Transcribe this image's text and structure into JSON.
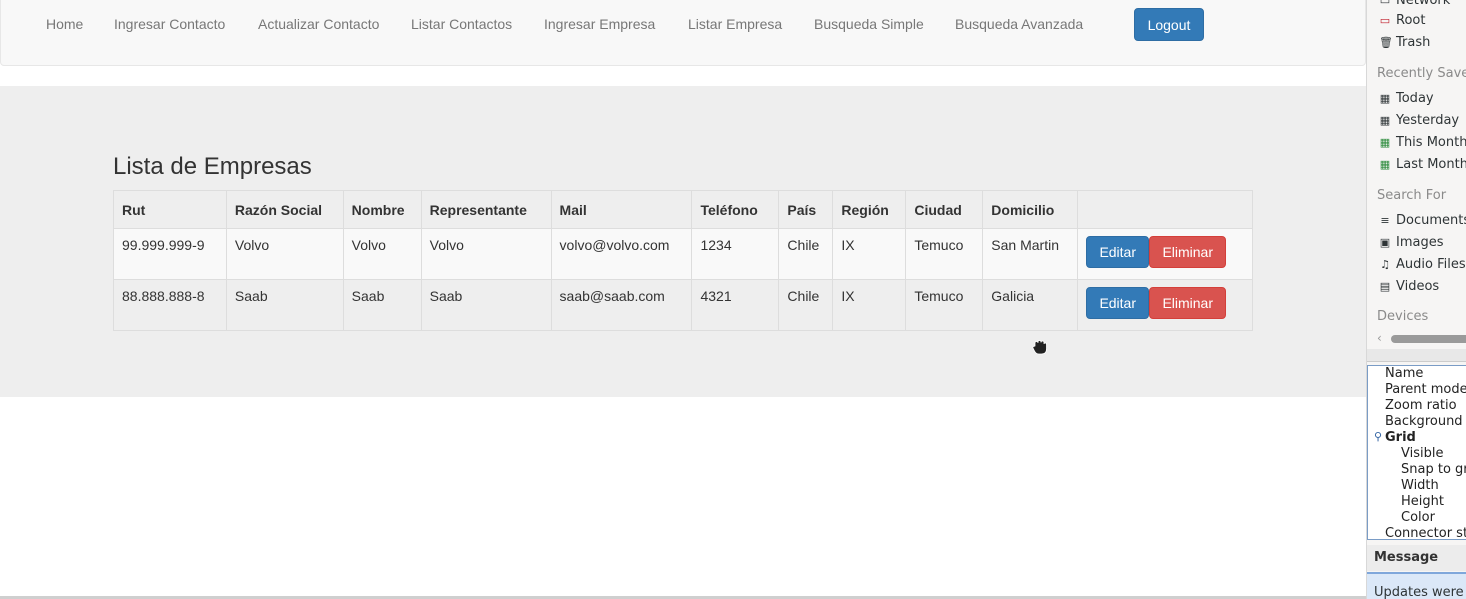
{
  "navbar": {
    "links": [
      "Home",
      "Ingresar Contacto",
      "Actualizar Contacto",
      "Listar Contactos",
      "Ingresar Empresa",
      "Listar Empresa",
      "Busqueda Simple",
      "Busqueda Avanzada"
    ],
    "logout_label": "Logout"
  },
  "main": {
    "title": "Lista de Empresas",
    "table": {
      "headers": [
        "Rut",
        "Razón Social",
        "Nombre",
        "Representante",
        "Mail",
        "Teléfono",
        "País",
        "Región",
        "Ciudad",
        "Domicilio",
        ""
      ],
      "rows": [
        [
          "99.999.999-9",
          "Volvo",
          "Volvo",
          "Volvo",
          "volvo@volvo.com",
          "1234",
          "Chile",
          "IX",
          "Temuco",
          "San Martin"
        ],
        [
          "88.888.888-8",
          "Saab",
          "Saab",
          "Saab",
          "saab@saab.com",
          "4321",
          "Chile",
          "IX",
          "Temuco",
          "Galicia"
        ]
      ],
      "edit_label": "Editar",
      "delete_label": "Eliminar"
    }
  },
  "side_panel": {
    "places": [
      "Network",
      "Root",
      "Trash"
    ],
    "recently_saved_header": "Recently Saved",
    "recently_saved": [
      "Today",
      "Yesterday",
      "This Month",
      "Last Month"
    ],
    "search_for_header": "Search For",
    "search_for": [
      "Documents",
      "Images",
      "Audio Files",
      "Videos"
    ],
    "devices_header": "Devices",
    "properties": {
      "rows": [
        "Name",
        "Parent mode",
        "Zoom ratio",
        "Background",
        "Grid",
        "Visible",
        "Snap to gr",
        "Width",
        "Height",
        "Color",
        "Connector st"
      ]
    },
    "message_header": "Message",
    "message_body": "Updates were"
  },
  "colors": {
    "primary": "#337ab7",
    "danger": "#d9534f",
    "navbar_bg": "#f8f8f8",
    "jumbotron_bg": "#eeeeee"
  }
}
